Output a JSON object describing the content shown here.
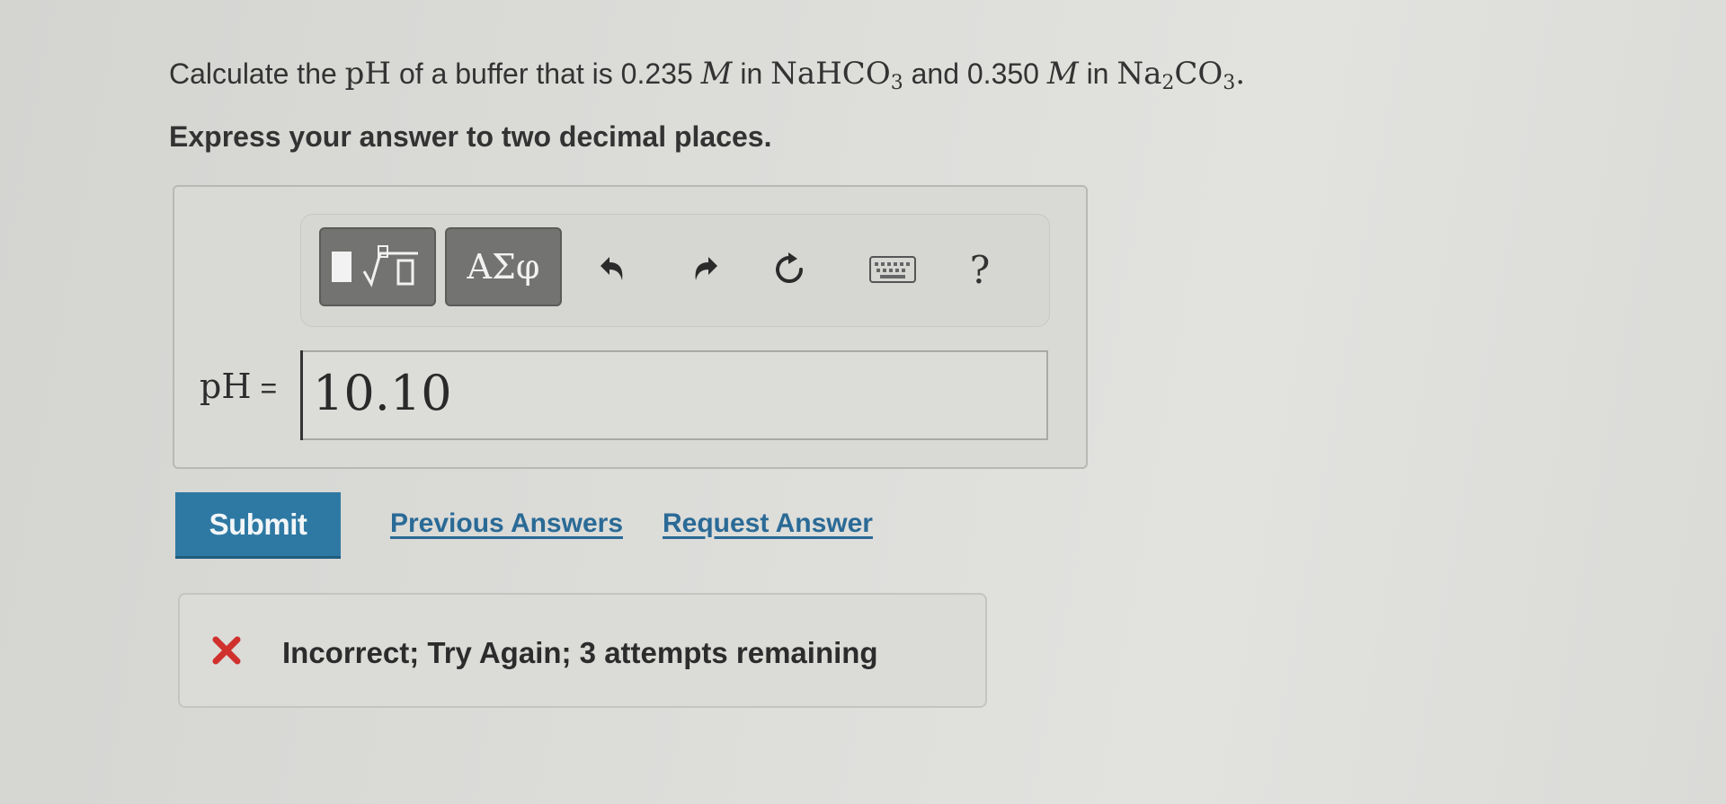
{
  "question": {
    "prefix": "Calculate the ",
    "ph_symbol": "pH",
    "part2": " of a buffer that is 0.235 ",
    "molar1": "M",
    "part3": " in ",
    "compound1_main": "NaHCO",
    "compound1_sub": "3",
    "part4": " and 0.350 ",
    "molar2": "M",
    "part5": " in ",
    "compound2_na": "Na",
    "compound2_na_sub": "2",
    "compound2_co": "CO",
    "compound2_co_sub": "3",
    "end": "."
  },
  "instruction": "Express your answer to two decimal places.",
  "toolbar": {
    "templates_icon": "templates-icon",
    "symbols_label": "ΑΣφ",
    "undo_icon": "undo-icon",
    "redo_icon": "redo-icon",
    "reset_icon": "reset-icon",
    "keyboard_icon": "keyboard-icon",
    "help_label": "?"
  },
  "answer": {
    "label": "pH",
    "equals": "=",
    "value": "10.10"
  },
  "actions": {
    "submit_label": "Submit",
    "previous_answers_label": "Previous Answers",
    "request_answer_label": "Request Answer"
  },
  "feedback": {
    "icon": "x-mark-icon",
    "message": "Incorrect; Try Again; 3 attempts remaining",
    "color": "#d0312d"
  },
  "colors": {
    "submit_bg": "#2e79a3",
    "link": "#2a6a96"
  }
}
